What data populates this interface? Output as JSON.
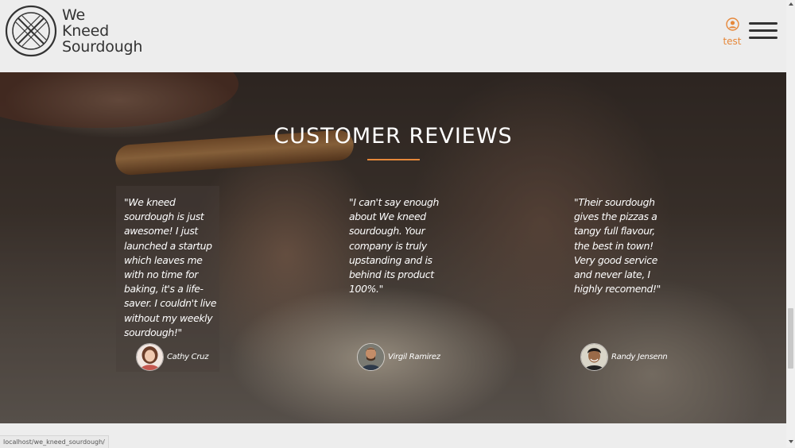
{
  "brand": {
    "line1": "We",
    "line2": "Kneed",
    "line3": "Sourdough",
    "accent_color": "#e6883a"
  },
  "header": {
    "account_label": "test",
    "account_icon": "user-circle-icon",
    "menu_icon": "hamburger-menu-icon"
  },
  "reviews_section": {
    "title": "CUSTOMER REVIEWS",
    "items": [
      {
        "quote": "\"We kneed sourdough is just awesome! I just launched a startup which leaves me with no time for baking, it's a life-saver. I couldn't live without my weekly sourdough!\"",
        "name": "Cathy Cruz"
      },
      {
        "quote": "\"I can't say enough about We kneed sourdough. Your company is truly upstanding and is behind its product 100%.\"",
        "name": "Virgil Ramirez"
      },
      {
        "quote": "\"Their sourdough gives the pizzas a tangy full flavour, the best in town! Very good service and never late, I highly recomend!\"",
        "name": "Randy Jensenn"
      }
    ]
  },
  "status_bar": {
    "url": "localhost/we_kneed_sourdough/"
  }
}
